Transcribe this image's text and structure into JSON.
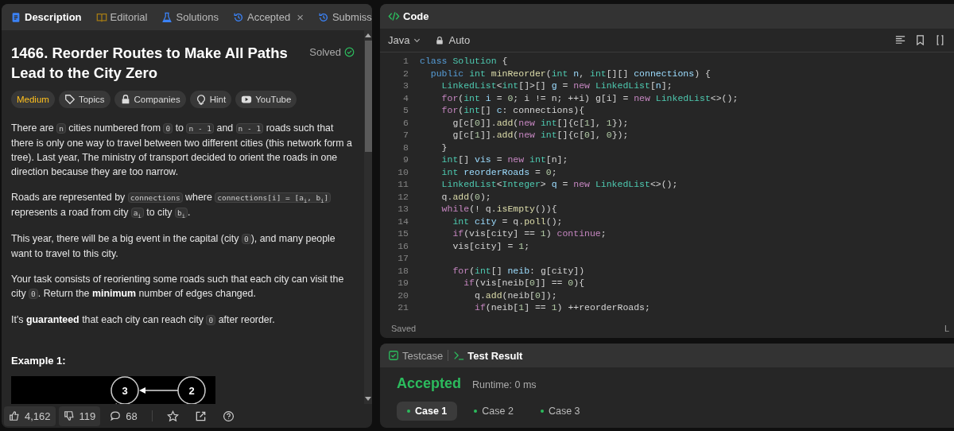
{
  "left_panel": {
    "tabs": [
      {
        "label": "Description",
        "selected": true
      },
      {
        "label": "Editorial",
        "selected": false
      },
      {
        "label": "Solutions",
        "selected": false
      },
      {
        "label": "Accepted",
        "selected": false,
        "close_label": "×"
      },
      {
        "label": "Submiss",
        "selected": false
      }
    ],
    "title": "1466. Reorder Routes to Make All Paths Lead to the City Zero",
    "status": "Solved",
    "tags": [
      {
        "kind": "difficulty",
        "label": "Medium"
      },
      {
        "kind": "tag",
        "label": "Topics"
      },
      {
        "kind": "tag",
        "label": "Companies"
      },
      {
        "kind": "tag",
        "label": "Hint"
      },
      {
        "kind": "tag",
        "label": "YouTube"
      }
    ],
    "paragraphs": [
      [
        {
          "kind": "text",
          "text": "There are "
        },
        {
          "kind": "code",
          "text": "n"
        },
        {
          "kind": "text",
          "text": " cities numbered from "
        },
        {
          "kind": "code",
          "text": "0"
        },
        {
          "kind": "text",
          "text": " to "
        },
        {
          "kind": "code",
          "text": "n - 1"
        },
        {
          "kind": "text",
          "text": " and "
        },
        {
          "kind": "code",
          "text": "n - 1"
        },
        {
          "kind": "text",
          "text": " roads such that there is only one way to travel between two different cities (this network form a tree). Last year, The ministry of transport decided to orient the roads in one direction because they are too narrow."
        }
      ],
      [
        {
          "kind": "text",
          "text": "Roads are represented by "
        },
        {
          "kind": "code",
          "text": "connections"
        },
        {
          "kind": "text",
          "text": " where "
        },
        {
          "kind": "code",
          "text": "connections[i] = [a$_{i}$, b$_{i}$]"
        },
        {
          "kind": "text",
          "text": " represents a road from city "
        },
        {
          "kind": "code",
          "text": "a$_{i}$"
        },
        {
          "kind": "text",
          "text": " to city "
        },
        {
          "kind": "code",
          "text": "b$_{i}$"
        },
        {
          "kind": "text",
          "text": "."
        }
      ],
      [
        {
          "kind": "text",
          "text": "This year, there will be a big event in the capital (city "
        },
        {
          "kind": "code",
          "text": "0"
        },
        {
          "kind": "text",
          "text": "), and many people want to travel to this city."
        }
      ],
      [
        {
          "kind": "text",
          "text": "Your task consists of reorienting some roads such that each city can visit the city "
        },
        {
          "kind": "code",
          "text": "0"
        },
        {
          "kind": "text",
          "text": ". Return the "
        },
        {
          "kind": "bold",
          "text": "minimum"
        },
        {
          "kind": "text",
          "text": " number of edges changed."
        }
      ],
      [
        {
          "kind": "text",
          "text": "It's "
        },
        {
          "kind": "bold",
          "text": "guaranteed"
        },
        {
          "kind": "text",
          "text": " that each city can reach city "
        },
        {
          "kind": "code",
          "text": "0"
        },
        {
          "kind": "text",
          "text": " after reorder."
        }
      ]
    ],
    "example": {
      "label": "Example 1:",
      "nodes": [
        "3",
        "2"
      ]
    },
    "footer": {
      "likes": "4,162",
      "dislikes": "119",
      "comments": "68"
    }
  },
  "code_panel": {
    "title": "Code",
    "language": "Java",
    "mode": "Auto",
    "lines": [
      {
        "number": "1",
        "tokens": [
          {
            "kind": "keyword",
            "text": "class "
          },
          {
            "kind": "type",
            "text": "Solution"
          },
          {
            "kind": "plain",
            "text": " {"
          }
        ]
      },
      {
        "number": "2",
        "tokens": [
          {
            "kind": "keyword",
            "text": "  public "
          },
          {
            "kind": "type",
            "text": "int "
          },
          {
            "kind": "function",
            "text": "minReorder"
          },
          {
            "kind": "plain",
            "text": "("
          },
          {
            "kind": "type",
            "text": "int "
          },
          {
            "kind": "variable",
            "text": "n"
          },
          {
            "kind": "plain",
            "text": ", "
          },
          {
            "kind": "type",
            "text": "int"
          },
          {
            "kind": "plain",
            "text": "[][] "
          },
          {
            "kind": "variable",
            "text": "connections"
          },
          {
            "kind": "plain",
            "text": ") {"
          }
        ]
      },
      {
        "number": "3",
        "tokens": [
          {
            "kind": "type",
            "text": "    LinkedList"
          },
          {
            "kind": "plain",
            "text": "<"
          },
          {
            "kind": "type",
            "text": "int"
          },
          {
            "kind": "plain",
            "text": "[]>[] "
          },
          {
            "kind": "variable",
            "text": "g"
          },
          {
            "kind": "plain",
            "text": " = "
          },
          {
            "kind": "control",
            "text": "new "
          },
          {
            "kind": "type",
            "text": "LinkedList"
          },
          {
            "kind": "plain",
            "text": "["
          },
          {
            "kind": "variable",
            "text": "n"
          },
          {
            "kind": "plain",
            "text": "];"
          }
        ]
      },
      {
        "number": "4",
        "tokens": [
          {
            "kind": "control",
            "text": "    for"
          },
          {
            "kind": "plain",
            "text": "("
          },
          {
            "kind": "type",
            "text": "int "
          },
          {
            "kind": "variable",
            "text": "i"
          },
          {
            "kind": "plain",
            "text": " = "
          },
          {
            "kind": "number",
            "text": "0"
          },
          {
            "kind": "plain",
            "text": "; i != n; ++i) g[i] = "
          },
          {
            "kind": "control",
            "text": "new "
          },
          {
            "kind": "type",
            "text": "LinkedList"
          },
          {
            "kind": "plain",
            "text": "<>();"
          }
        ]
      },
      {
        "number": "5",
        "tokens": [
          {
            "kind": "control",
            "text": "    for"
          },
          {
            "kind": "plain",
            "text": "("
          },
          {
            "kind": "type",
            "text": "int"
          },
          {
            "kind": "plain",
            "text": "[] "
          },
          {
            "kind": "variable",
            "text": "c"
          },
          {
            "kind": "plain",
            "text": ": connections){"
          }
        ]
      },
      {
        "number": "6",
        "tokens": [
          {
            "kind": "plain",
            "text": "      g[c["
          },
          {
            "kind": "number",
            "text": "0"
          },
          {
            "kind": "plain",
            "text": "]]."
          },
          {
            "kind": "function",
            "text": "add"
          },
          {
            "kind": "plain",
            "text": "("
          },
          {
            "kind": "control",
            "text": "new "
          },
          {
            "kind": "type",
            "text": "int"
          },
          {
            "kind": "plain",
            "text": "[]{c["
          },
          {
            "kind": "number",
            "text": "1"
          },
          {
            "kind": "plain",
            "text": "], "
          },
          {
            "kind": "number",
            "text": "1"
          },
          {
            "kind": "plain",
            "text": "});"
          }
        ]
      },
      {
        "number": "7",
        "tokens": [
          {
            "kind": "plain",
            "text": "      g[c["
          },
          {
            "kind": "number",
            "text": "1"
          },
          {
            "kind": "plain",
            "text": "]]."
          },
          {
            "kind": "function",
            "text": "add"
          },
          {
            "kind": "plain",
            "text": "("
          },
          {
            "kind": "control",
            "text": "new "
          },
          {
            "kind": "type",
            "text": "int"
          },
          {
            "kind": "plain",
            "text": "[]{c["
          },
          {
            "kind": "number",
            "text": "0"
          },
          {
            "kind": "plain",
            "text": "], "
          },
          {
            "kind": "number",
            "text": "0"
          },
          {
            "kind": "plain",
            "text": "});"
          }
        ]
      },
      {
        "number": "8",
        "tokens": [
          {
            "kind": "plain",
            "text": "    }"
          }
        ]
      },
      {
        "number": "9",
        "tokens": [
          {
            "kind": "type",
            "text": "    int"
          },
          {
            "kind": "plain",
            "text": "[] "
          },
          {
            "kind": "variable",
            "text": "vis"
          },
          {
            "kind": "plain",
            "text": " = "
          },
          {
            "kind": "control",
            "text": "new "
          },
          {
            "kind": "type",
            "text": "int"
          },
          {
            "kind": "plain",
            "text": "[n];"
          }
        ]
      },
      {
        "number": "10",
        "tokens": [
          {
            "kind": "type",
            "text": "    int "
          },
          {
            "kind": "variable",
            "text": "reorderRoads"
          },
          {
            "kind": "plain",
            "text": " = "
          },
          {
            "kind": "number",
            "text": "0"
          },
          {
            "kind": "plain",
            "text": ";"
          }
        ]
      },
      {
        "number": "11",
        "tokens": [
          {
            "kind": "type",
            "text": "    LinkedList"
          },
          {
            "kind": "plain",
            "text": "<"
          },
          {
            "kind": "type",
            "text": "Integer"
          },
          {
            "kind": "plain",
            "text": "> "
          },
          {
            "kind": "variable",
            "text": "q"
          },
          {
            "kind": "plain",
            "text": " = "
          },
          {
            "kind": "control",
            "text": "new "
          },
          {
            "kind": "type",
            "text": "LinkedList"
          },
          {
            "kind": "plain",
            "text": "<>();"
          }
        ]
      },
      {
        "number": "12",
        "tokens": [
          {
            "kind": "plain",
            "text": "    q."
          },
          {
            "kind": "function",
            "text": "add"
          },
          {
            "kind": "plain",
            "text": "("
          },
          {
            "kind": "number",
            "text": "0"
          },
          {
            "kind": "plain",
            "text": ");"
          }
        ]
      },
      {
        "number": "13",
        "tokens": [
          {
            "kind": "control",
            "text": "    while"
          },
          {
            "kind": "plain",
            "text": "(! q."
          },
          {
            "kind": "function",
            "text": "isEmpty"
          },
          {
            "kind": "plain",
            "text": "()){"
          }
        ]
      },
      {
        "number": "14",
        "tokens": [
          {
            "kind": "type",
            "text": "      int "
          },
          {
            "kind": "variable",
            "text": "city"
          },
          {
            "kind": "plain",
            "text": " = q."
          },
          {
            "kind": "function",
            "text": "poll"
          },
          {
            "kind": "plain",
            "text": "();"
          }
        ]
      },
      {
        "number": "15",
        "tokens": [
          {
            "kind": "control",
            "text": "      if"
          },
          {
            "kind": "plain",
            "text": "(vis[city] == "
          },
          {
            "kind": "number",
            "text": "1"
          },
          {
            "kind": "plain",
            "text": ") "
          },
          {
            "kind": "control",
            "text": "continue"
          },
          {
            "kind": "plain",
            "text": ";"
          }
        ]
      },
      {
        "number": "16",
        "tokens": [
          {
            "kind": "plain",
            "text": "      vis[city] = "
          },
          {
            "kind": "number",
            "text": "1"
          },
          {
            "kind": "plain",
            "text": ";"
          }
        ]
      },
      {
        "number": "17"
      },
      {
        "number": "18",
        "tokens": [
          {
            "kind": "control",
            "text": "      for"
          },
          {
            "kind": "plain",
            "text": "("
          },
          {
            "kind": "type",
            "text": "int"
          },
          {
            "kind": "plain",
            "text": "[] "
          },
          {
            "kind": "variable",
            "text": "neib"
          },
          {
            "kind": "plain",
            "text": ": g[city])"
          }
        ]
      },
      {
        "number": "19",
        "tokens": [
          {
            "kind": "control",
            "text": "        if"
          },
          {
            "kind": "plain",
            "text": "(vis[neib["
          },
          {
            "kind": "number",
            "text": "0"
          },
          {
            "kind": "plain",
            "text": "]] == "
          },
          {
            "kind": "number",
            "text": "0"
          },
          {
            "kind": "plain",
            "text": "){"
          }
        ]
      },
      {
        "number": "20",
        "tokens": [
          {
            "kind": "plain",
            "text": "          q."
          },
          {
            "kind": "function",
            "text": "add"
          },
          {
            "kind": "plain",
            "text": "(neib["
          },
          {
            "kind": "number",
            "text": "0"
          },
          {
            "kind": "plain",
            "text": "]);"
          }
        ]
      },
      {
        "number": "21",
        "tokens": [
          {
            "kind": "control",
            "text": "          if"
          },
          {
            "kind": "plain",
            "text": "(neib["
          },
          {
            "kind": "number",
            "text": "1"
          },
          {
            "kind": "plain",
            "text": "] == "
          },
          {
            "kind": "number",
            "text": "1"
          },
          {
            "kind": "plain",
            "text": ") ++reorderRoads;"
          }
        ]
      }
    ],
    "status": "Saved",
    "status_right": "L"
  },
  "result_panel": {
    "tabs": [
      {
        "label": "Testcase",
        "selected": false
      },
      {
        "label": "Test Result",
        "selected": true
      }
    ],
    "verdict": "Accepted",
    "runtime": "Runtime: 0 ms",
    "cases": [
      {
        "label": "Case 1",
        "selected": true
      },
      {
        "label": "Case 2",
        "selected": false
      },
      {
        "label": "Case 3",
        "selected": false
      }
    ]
  }
}
